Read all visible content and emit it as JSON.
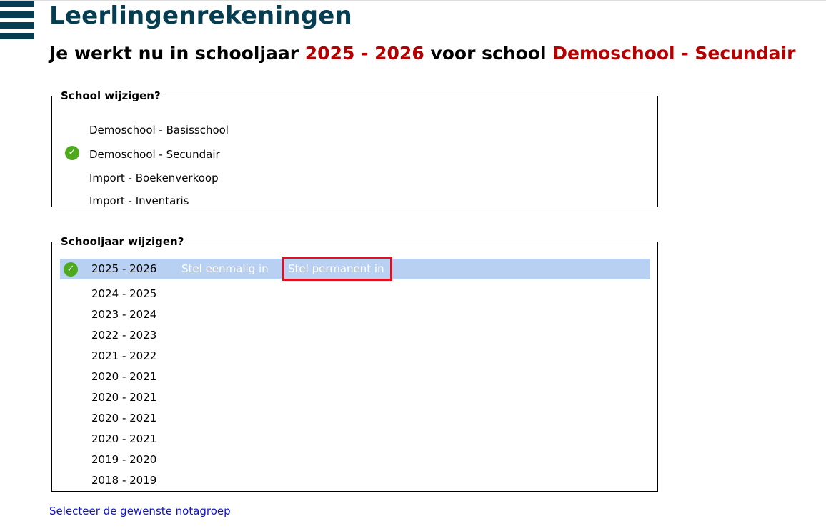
{
  "header": {
    "title": "Leerlingenrekeningen",
    "menu_icon": "hamburger-menu-icon",
    "context_prefix": "Je werkt nu in schooljaar",
    "context_year": "2025 - 2026",
    "context_middle": "voor school",
    "context_school": "Demoschool - Secundair"
  },
  "colors": {
    "brand": "#063d50",
    "highlight_text": "#b40000",
    "selected_row": "#b8d0f2",
    "check": "#4caa1c",
    "focus_box": "#e0101e",
    "link": "#1010d0"
  },
  "school_section": {
    "legend": "School wijzigen?",
    "items": [
      "Demoschool - Basisschool",
      "Demoschool - Secundair",
      "Import - Boekenverkoop",
      "Import - Inventaris"
    ],
    "selected": "Demoschool - Secundair",
    "check_icon": "check-circle-icon"
  },
  "year_section": {
    "legend": "Schooljaar wijzigen?",
    "selected": "2025 - 2026",
    "set_once_label": "Stel eenmalig in",
    "set_permanent_label": "Stel permanent in",
    "items": [
      "2025 - 2026",
      "2024 - 2025",
      "2023 - 2024",
      "2022 - 2023",
      "2021 - 2022",
      "2020 - 2021",
      "2020 - 2021",
      "2020 - 2021",
      "2020 - 2021",
      "2019 - 2020",
      "2018 - 2019"
    ]
  },
  "footer": {
    "link_label": "Selecteer de gewenste notagroep"
  }
}
